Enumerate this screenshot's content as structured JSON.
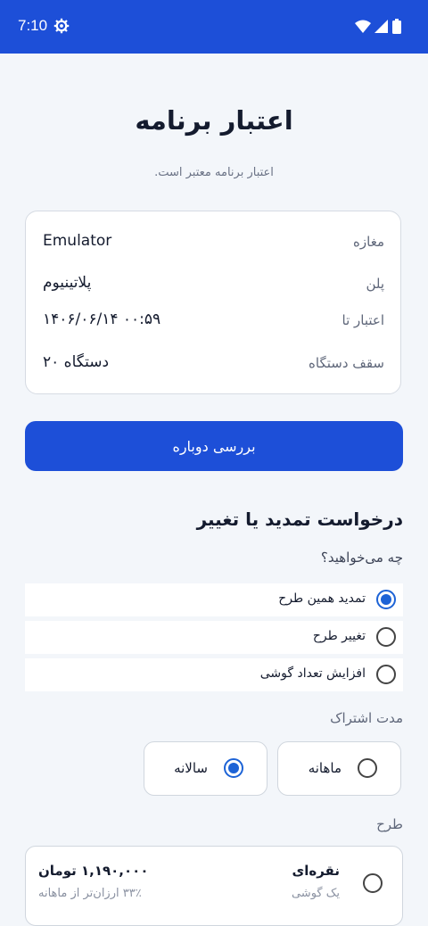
{
  "status_bar": {
    "time": "7:10"
  },
  "header": {
    "title": "اعتبار برنامه",
    "subtitle": "اعتبار برنامه معتبر است."
  },
  "info": {
    "rows": [
      {
        "label": "مغازه",
        "value": "Emulator"
      },
      {
        "label": "پلن",
        "value": "پلاتینیوم"
      },
      {
        "label": "اعتبار تا",
        "value": "۱۴۰۶/۰۶/۱۴ ۰۰:۵۹"
      },
      {
        "label": "سقف دستگاه",
        "value": "۲۰ دستگاه"
      }
    ]
  },
  "recheck_label": "بررسی دوباره",
  "request": {
    "title": "درخواست تمدید یا تغییر",
    "question": "چه می‌خواهید؟",
    "options": [
      {
        "label": "تمدید همین طرح",
        "selected": true
      },
      {
        "label": "تغییر طرح",
        "selected": false
      },
      {
        "label": "افزایش تعداد گوشی",
        "selected": false
      }
    ]
  },
  "duration": {
    "label": "مدت اشتراک",
    "monthly": "ماهانه",
    "yearly": "سالانه",
    "selected": "yearly"
  },
  "plan": {
    "label": "طرح",
    "name": "نقره‌ای",
    "sub": "یک گوشی",
    "price": "۱,۱۹۰,۰۰۰ تومان",
    "saving": "۳۳٪ ارزان‌تر از ماهانه"
  },
  "colors": {
    "primary": "#1d4fd8",
    "radio": "#1d63d6",
    "background": "#f3f6fa"
  },
  "icons": [
    "gear-icon",
    "wifi-icon",
    "signal-icon",
    "battery-icon"
  ]
}
